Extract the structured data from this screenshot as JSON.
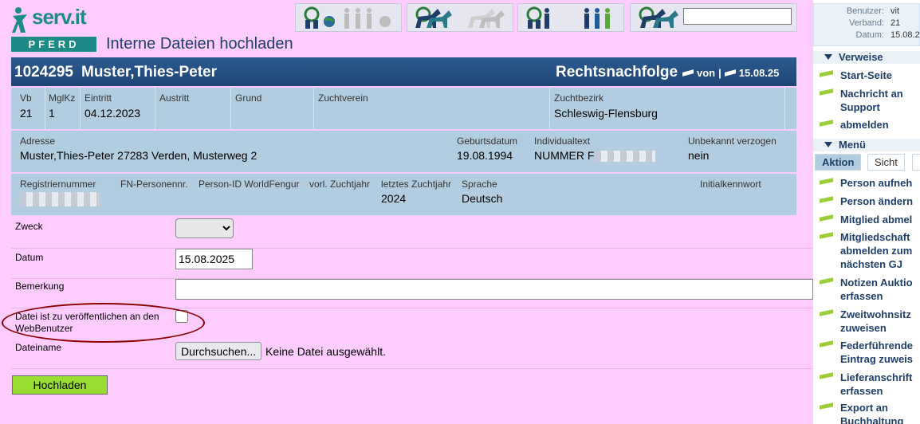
{
  "header": {
    "logo_text": "serv.it",
    "logo_sub": "PFERD",
    "page_title": "Interne Dateien hochladen"
  },
  "toolbar": {
    "buttons": [
      "people-globe-icon",
      "horses-icon",
      "people-icon",
      "search-horse-icon"
    ],
    "search_value": ""
  },
  "record": {
    "id": "1024295",
    "name": "Muster,Thies-Peter",
    "title": "Rechtsnachfolge",
    "von": "von",
    "date": "15.08.25"
  },
  "info": {
    "vb_label": "Vb",
    "vb": "21",
    "mglkz_label": "MglKz",
    "mglkz": "1",
    "eintritt_label": "Eintritt",
    "eintritt": "04.12.2023",
    "austritt_label": "Austritt",
    "grund_label": "Grund",
    "zuchtverein_label": "Zuchtverein",
    "zuchtbezirk_label": "Zuchtbezirk",
    "zuchtbezirk": "Schleswig-Flensburg",
    "adresse_label": "Adresse",
    "adresse": "Muster,Thies-Peter 27283 Verden, Musterweg 2",
    "geburtsdatum_label": "Geburtsdatum",
    "geburtsdatum": "19.08.1994",
    "individualtext_label": "Individualtext",
    "individualtext": "NUMMER F",
    "unbekannt_label": "Unbekannt verzogen",
    "unbekannt": "nein",
    "registriernummer_label": "Registriernummer",
    "fn_label": "FN-Personennr.",
    "personid_label": "Person-ID WorldFengur",
    "vorl_label": "vorl. Zuchtjahr",
    "letztes_label": "letztes Zuchtjahr",
    "letztes": "2024",
    "sprache_label": "Sprache",
    "sprache": "Deutsch",
    "initial_label": "Initialkennwort"
  },
  "form": {
    "zweck_label": "Zweck",
    "zweck_value": "",
    "datum_label": "Datum",
    "datum_value": "15.08.2025",
    "bemerkung_label": "Bemerkung",
    "bemerkung_value": "",
    "publish_label": "Datei ist zu veröffentlichen an den WebBenutzer",
    "dateiname_label": "Dateiname",
    "browse_label": "Durchsuchen...",
    "no_file": "Keine Datei ausgewählt.",
    "upload_label": "Hochladen"
  },
  "sidebar": {
    "benutzer_label": "Benutzer:",
    "benutzer": "vit",
    "verband_label": "Verband:",
    "verband": "21",
    "datum_label": "Datum:",
    "datum": "15.08.2",
    "verweise_title": "Verweise",
    "verweise": [
      "Start-Seite",
      "Nachricht an Support",
      "abmelden"
    ],
    "menu_title": "Menü",
    "tabs": [
      "Aktion",
      "Sicht",
      "I"
    ],
    "actions": [
      "Person aufneh",
      "Person ändern",
      "Mitglied abmel",
      "Mitgliedschaft abmelden zum nächsten GJ",
      "Notizen Auktio erfassen",
      "Zweitwohnsitz zuweisen",
      "Federführende Eintrag zuweis",
      "Lieferanschrift erfassen",
      "Export an Buchhaltung"
    ]
  }
}
